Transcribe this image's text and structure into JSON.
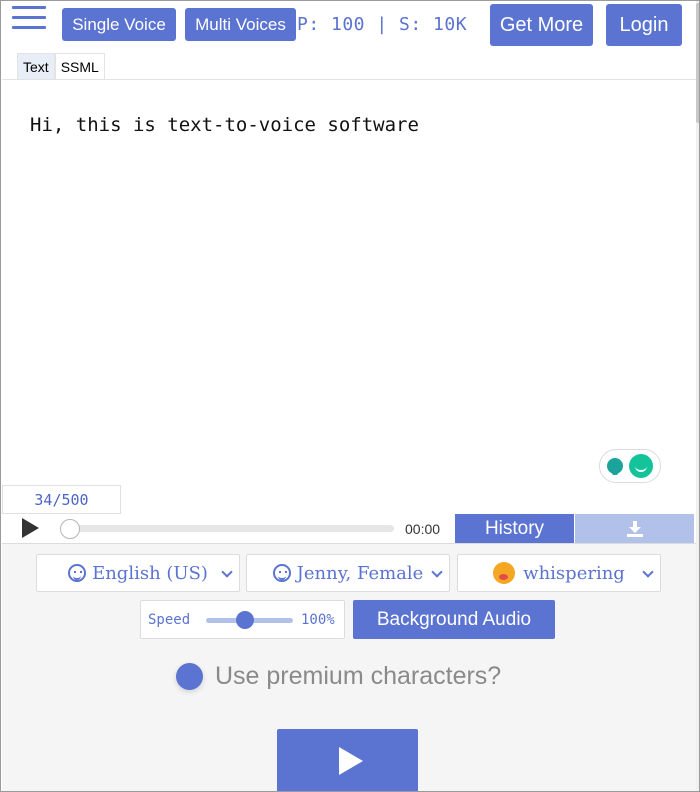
{
  "header": {
    "single_voice": "Single Voice",
    "multi_voices": "Multi Voices",
    "counter": "P: 100 | S: 10K",
    "get_more": "Get More",
    "login": "Login"
  },
  "tabs": [
    {
      "label": "Text",
      "active": true
    },
    {
      "label": "SSML",
      "active": false
    }
  ],
  "editor": {
    "text": "Hi, this is text-to-voice software",
    "char_count": "34/500"
  },
  "player": {
    "time": "00:00",
    "history_label": "History",
    "progress": 0
  },
  "settings": {
    "language": "English (US)",
    "voice": "Jenny, Female",
    "style": "whispering",
    "speed_label": "Speed",
    "speed_value": "100%",
    "background_audio": "Background Audio",
    "premium_label": "Use premium characters?"
  },
  "icons": {
    "menu": "hamburger-menu-icon",
    "grammar": "grammarly-icon",
    "play": "play-icon",
    "download": "download-icon",
    "language": "smiley-icon",
    "voice": "smiley-icon",
    "style": "whisper-emoji-icon"
  },
  "colors": {
    "accent": "#5b73d1",
    "accent_light": "#b2c1ea"
  }
}
